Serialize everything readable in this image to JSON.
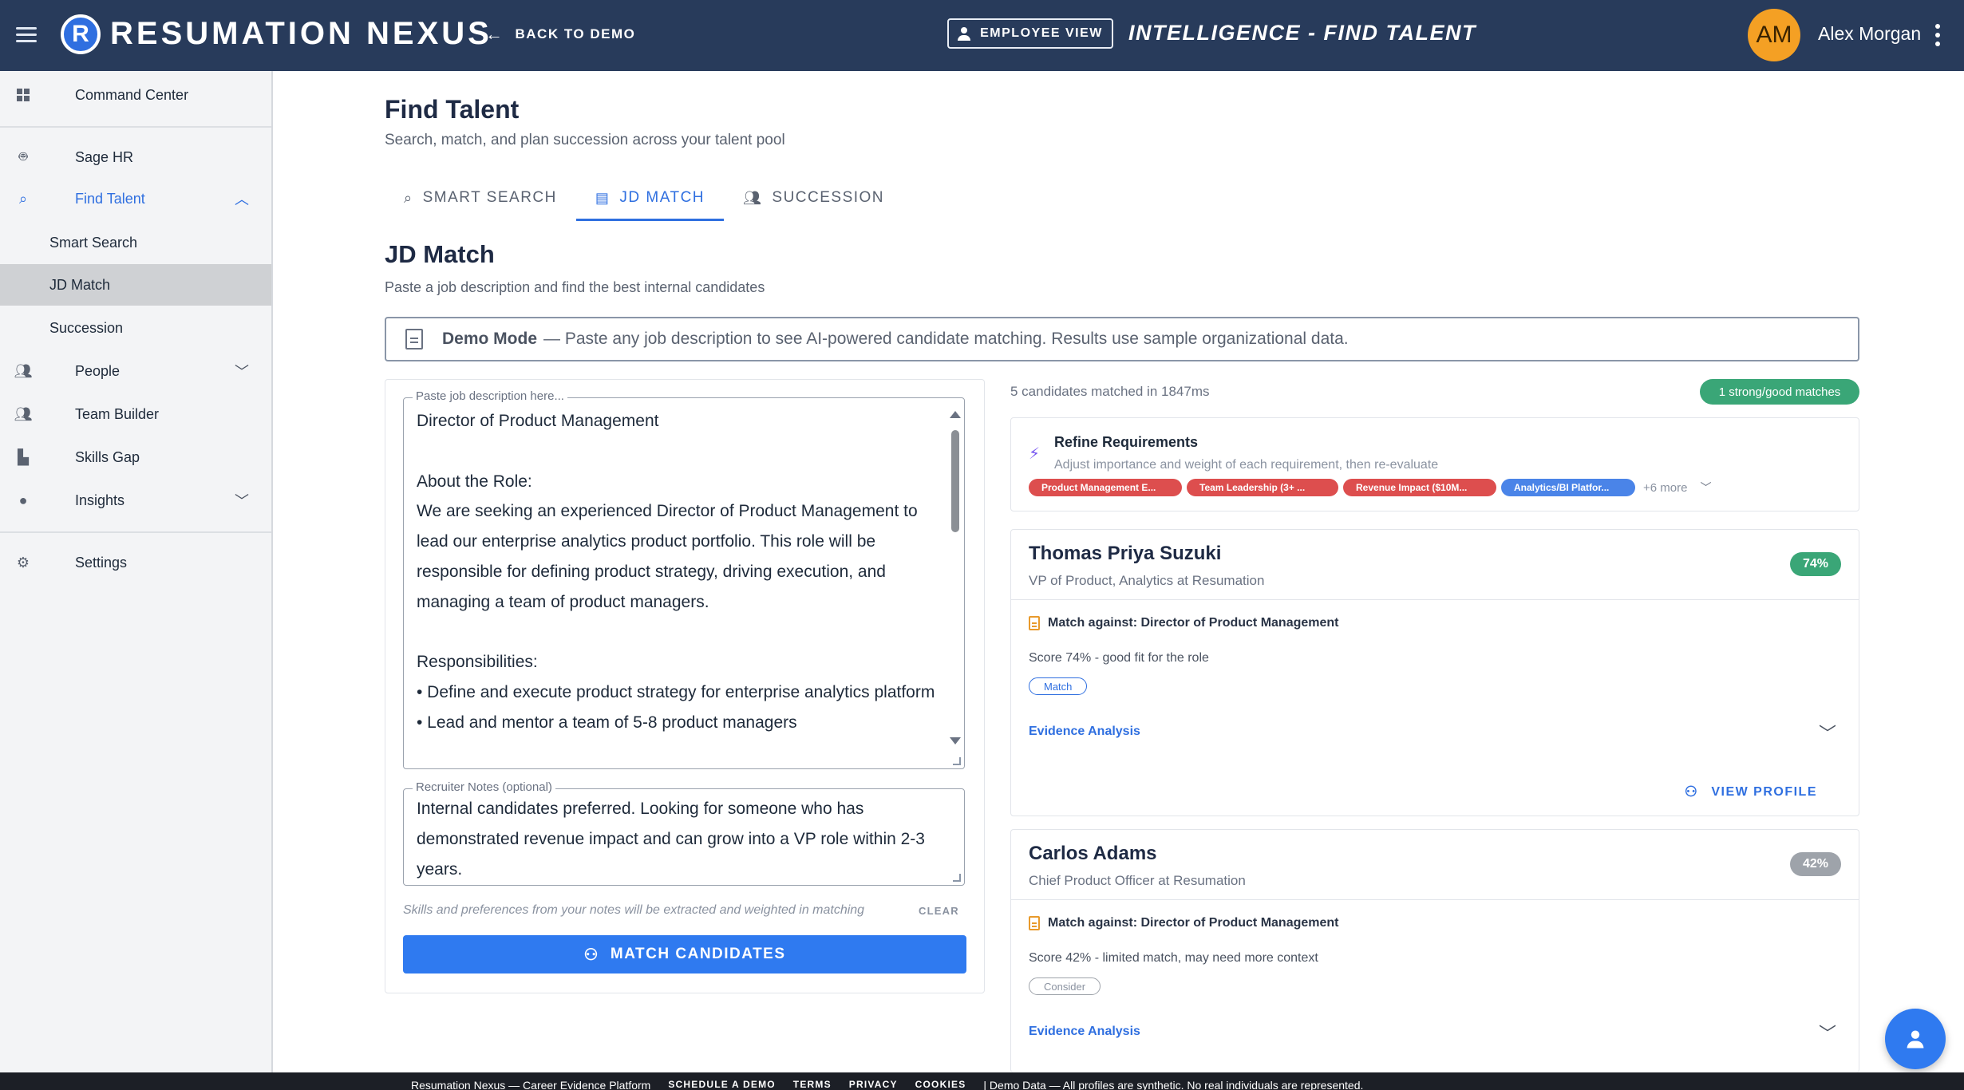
{
  "topbar": {
    "logo_letter": "R",
    "brand": "RESUMATION NEXUS",
    "back_label": "BACK TO DEMO",
    "employee_view_label": "EMPLOYEE VIEW",
    "page_heading": "INTELLIGENCE - FIND TALENT",
    "avatar_initials": "AM",
    "user_name": "Alex Morgan"
  },
  "sidebar": {
    "command_center": "Command Center",
    "sage_hr": "Sage HR",
    "find_talent": "Find Talent",
    "smart_search": "Smart Search",
    "jd_match": "JD Match",
    "succession": "Succession",
    "people": "People",
    "team_builder": "Team Builder",
    "skills_gap": "Skills Gap",
    "insights": "Insights",
    "settings": "Settings"
  },
  "main": {
    "title": "Find Talent",
    "subtitle": "Search, match, and plan succession across your talent pool",
    "tabs": [
      {
        "label": "SMART SEARCH"
      },
      {
        "label": "JD MATCH"
      },
      {
        "label": "SUCCESSION"
      }
    ],
    "section_title": "JD Match",
    "section_subtitle": "Paste a job description and find the best internal candidates",
    "demo_bold": "Demo Mode",
    "demo_text": "— Paste any job description to see AI-powered candidate matching. Results use sample organizational data."
  },
  "form": {
    "jd_label": "Paste job description here...",
    "jd_value": "Director of Product Management\n\nAbout the Role:\nWe are seeking an experienced Director of Product Management to lead our enterprise analytics product portfolio. This role will be responsible for defining product strategy, driving execution, and managing a team of product managers.\n\nResponsibilities:\n• Define and execute product strategy for enterprise analytics platform\n• Lead and mentor a team of 5-8 product managers",
    "notes_label": "Recruiter Notes (optional)",
    "notes_value": "Internal candidates preferred. Looking for someone who has demonstrated revenue impact and can grow into a VP role within 2-3 years.",
    "hint": "Skills and preferences from your notes will be extracted and weighted in matching",
    "clear_label": "CLEAR",
    "match_button": "MATCH CANDIDATES"
  },
  "results": {
    "meta": "5 candidates matched in 1847ms",
    "strong_badge": "1 strong/good matches",
    "refine_title": "Refine Requirements",
    "refine_sub": "Adjust importance and weight of each requirement, then re-evaluate",
    "chips": [
      "Product Management E...",
      "Team Leadership (3+ ...",
      "Revenue Impact ($10M...",
      "Analytics/BI Platfor..."
    ],
    "more": "+6 more",
    "candidates": [
      {
        "name": "Thomas Priya Suzuki",
        "role": "VP of Product, Analytics at Resumation",
        "score": "74%",
        "match_against": "Match against: Director of Product Management",
        "score_text": "Score 74% - good fit for the role",
        "tag": "Match",
        "evidence": "Evidence Analysis",
        "view_profile": "VIEW PROFILE"
      },
      {
        "name": "Carlos Adams",
        "role": "Chief Product Officer at Resumation",
        "score": "42%",
        "match_against": "Match against: Director of Product Management",
        "score_text": "Score 42% - limited match, may need more context",
        "tag": "Consider",
        "evidence": "Evidence Analysis"
      }
    ]
  },
  "footer": {
    "platform": "Resumation Nexus — Career Evidence Platform",
    "schedule": "SCHEDULE A DEMO",
    "terms": "TERMS",
    "privacy": "PRIVACY",
    "cookies": "COOKIES",
    "disclaimer": "| Demo Data — All profiles are synthetic. No real individuals are represented."
  },
  "colors": {
    "topbar": "#283b5b",
    "accent": "#2f6fe0",
    "success": "#3aa677",
    "danger": "#dd4e4e"
  }
}
